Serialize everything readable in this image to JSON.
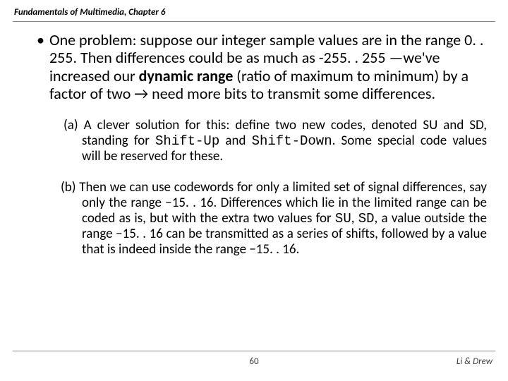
{
  "header": {
    "text": "Fundamentals of Multimedia, Chapter 6"
  },
  "bullet": {
    "mark": "•",
    "pre": "One problem: suppose our integer sample values are in the range 0. . 255. Then differences could be as much as -255. . 255 —we've increased our ",
    "bold": "dynamic range",
    "post": " (ratio of maximum to minimum) by a factor of two → need more bits to transmit some differences."
  },
  "sub_a": {
    "label": "(a) ",
    "t1": "A clever solution for this: define two new codes, denoted SU and SD, standing for ",
    "code1": "Shift-Up",
    "t2": " and ",
    "code2": "Shift-Down",
    "t3": ". Some special code values will be reserved for these."
  },
  "sub_b": {
    "label": "(b) ",
    "t1": "Then we can use codewords for only a limited set of signal differences, say only the range −15. . 16. Differences which lie in the limited range can be coded as is, but with the extra two values for ",
    "code1": "SU",
    "t2": ", ",
    "code2": "SD",
    "t3": ", a value outside the range −15. . 16 can be transmitted as a series of shifts, followed by a value that is indeed inside the range −15. . 16."
  },
  "footer": {
    "page": "60",
    "authors": "Li & Drew"
  }
}
